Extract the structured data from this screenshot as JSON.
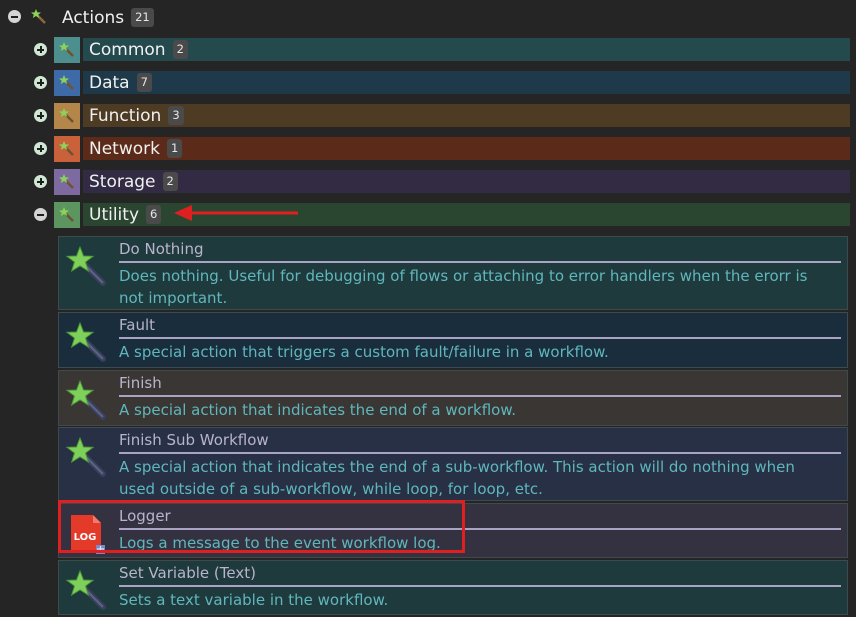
{
  "root": {
    "label": "Actions",
    "count": "21"
  },
  "categories": [
    {
      "label": "Common",
      "count": "2",
      "expanded": false,
      "color": "#244a4e",
      "icon_bg": "#4d8f8f"
    },
    {
      "label": "Data",
      "count": "7",
      "expanded": false,
      "color": "#1e3a4a",
      "icon_bg": "#3f6aa8"
    },
    {
      "label": "Function",
      "count": "3",
      "expanded": false,
      "color": "#4d3b24",
      "icon_bg": "#b5864a"
    },
    {
      "label": "Network",
      "count": "1",
      "expanded": false,
      "color": "#5c2a18",
      "icon_bg": "#c9623a"
    },
    {
      "label": "Storage",
      "count": "2",
      "expanded": false,
      "color": "#332b44",
      "icon_bg": "#7c6aa0"
    },
    {
      "label": "Utility",
      "count": "6",
      "expanded": true,
      "color": "#2a4630",
      "icon_bg": "#5d9560"
    }
  ],
  "actions": [
    {
      "title": "Do Nothing",
      "desc": "Does nothing. Useful for debugging of flows or attaching to error handlers when the erorr is not important.",
      "icon": "wand-icon",
      "bg": "#1f3a3c"
    },
    {
      "title": "Fault",
      "desc": "A special action that triggers a custom fault/failure in a workflow.",
      "icon": "wand-icon",
      "bg": "#1a2d3d"
    },
    {
      "title": "Finish",
      "desc": "A special action that indicates the end of a workflow.",
      "icon": "wand-icon",
      "bg": "#3a3634"
    },
    {
      "title": "Finish Sub Workflow",
      "desc": "A special action that indicates the end of a sub-workflow. This action will do nothing when used outside of a sub-workflow, while loop, for loop, etc.",
      "icon": "wand-icon",
      "bg": "#273044"
    },
    {
      "title": "Logger",
      "desc": "Logs a message to the event workflow log.",
      "icon": "log-file-icon",
      "bg": "#343240"
    },
    {
      "title": "Set Variable (Text)",
      "desc": "Sets a text variable in the workflow.",
      "icon": "wand-icon",
      "bg": "#1f3a3c"
    }
  ],
  "icon_text": {
    "log": "LOG"
  },
  "annotation": {
    "color": "#e02020"
  }
}
